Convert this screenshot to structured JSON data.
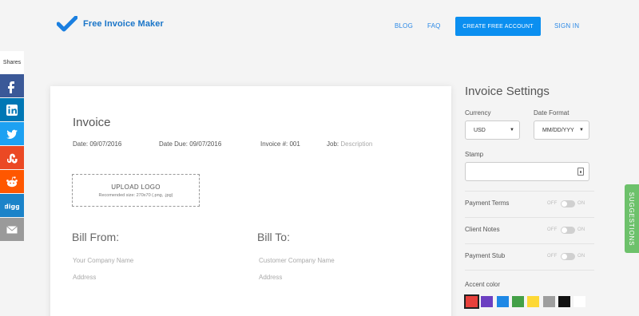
{
  "header": {
    "brand": "Free Invoice Maker",
    "nav": {
      "blog": "BLOG",
      "faq": "FAQ",
      "create_account": "CREATE FREE ACCOUNT",
      "sign_in": "SIGN IN"
    }
  },
  "share": {
    "label": "Shares",
    "buttons": [
      {
        "name": "facebook-icon",
        "glyph": "f",
        "color": "#3b5998"
      },
      {
        "name": "linkedin-icon",
        "glyph": "in",
        "color": "#0077b5"
      },
      {
        "name": "twitter-icon",
        "glyph": "t",
        "color": "#1da1f2"
      },
      {
        "name": "stumbleupon-icon",
        "glyph": "su",
        "color": "#eb4924"
      },
      {
        "name": "reddit-icon",
        "glyph": "r",
        "color": "#ff5700"
      },
      {
        "name": "digg-icon",
        "glyph": "digg",
        "color": "#1b83c9"
      },
      {
        "name": "email-icon",
        "glyph": "mail",
        "color": "#9a9a9a"
      }
    ]
  },
  "invoice": {
    "title": "Invoice",
    "date_label": "Date: 09/07/2016",
    "date_due_label": "Date Due: 09/07/2016",
    "number_label": "Invoice #: 001",
    "job_label": "Job:",
    "job_placeholder": "Description",
    "upload_title": "UPLOAD LOGO",
    "upload_hint": "Recomended size: 270x70 (.png, .jpg)",
    "bill_from": {
      "heading": "Bill From:",
      "company_placeholder": "Your Company Name",
      "address_placeholder": "Address"
    },
    "bill_to": {
      "heading": "Bill To:",
      "company_placeholder": "Customer Company Name",
      "address_placeholder": "Address"
    }
  },
  "settings": {
    "title": "Invoice Settings",
    "currency_label": "Currency",
    "currency_value": "USD",
    "date_format_label": "Date Format",
    "date_format_value": "MM/DD/YYY",
    "stamp_label": "Stamp",
    "toggles": [
      {
        "label": "Payment Terms",
        "off": "OFF",
        "on": "ON",
        "enabled": false
      },
      {
        "label": "Client Notes",
        "off": "OFF",
        "on": "ON",
        "enabled": false
      },
      {
        "label": "Payment Stub",
        "off": "OFF",
        "on": "ON",
        "enabled": false
      }
    ],
    "accent_label": "Accent color",
    "accent_colors": [
      "#e8413c",
      "#6c3fc1",
      "#1e88e5",
      "#43a047",
      "#fdd835",
      "#9e9e9e",
      "#111111",
      "#ffffff"
    ],
    "accent_selected": "#e8413c"
  },
  "suggestions": {
    "label": "SUGGESTIONS"
  },
  "colors": {
    "brand_blue": "#0b8ff0",
    "link_blue": "#2a88e6",
    "suggest_green": "#6dc16b"
  }
}
